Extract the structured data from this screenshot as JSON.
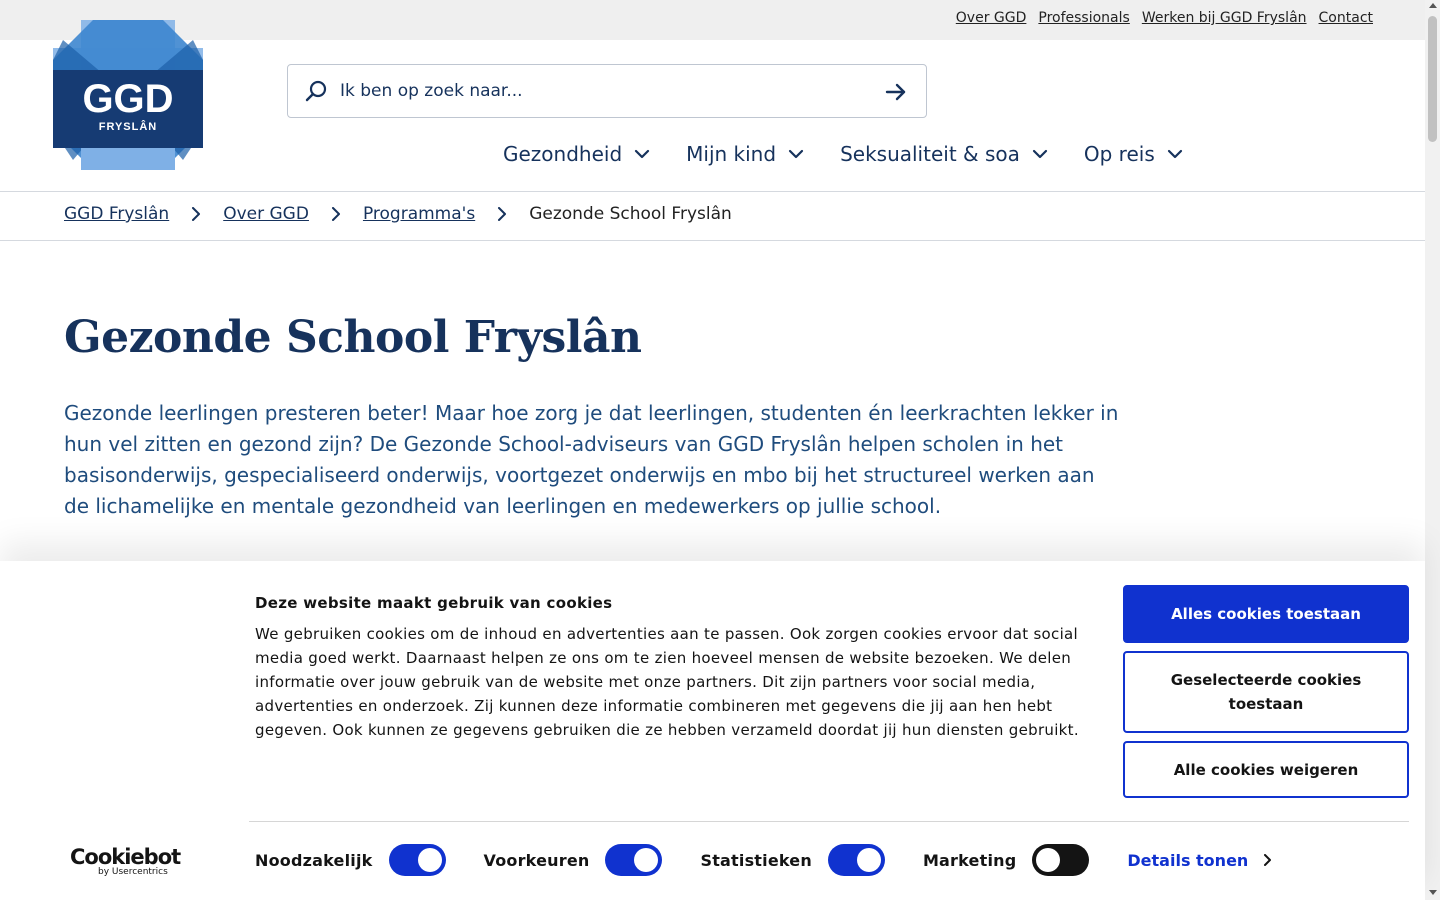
{
  "topbar": {
    "links": [
      "Over GGD",
      "Professionals",
      "Werken bij GGD Fryslân",
      "Contact"
    ]
  },
  "logo": {
    "text": "GGD",
    "subtext": "FRYSLÂN"
  },
  "search": {
    "placeholder": "Ik ben op zoek naar..."
  },
  "nav": [
    "Gezondheid",
    "Mijn kind",
    "Seksualiteit & soa",
    "Op reis"
  ],
  "breadcrumb": {
    "items": [
      "GGD Fryslân",
      "Over GGD",
      "Programma's"
    ],
    "current": "Gezonde School Fryslân"
  },
  "page": {
    "title": "Gezonde School Fryslân",
    "intro": "Gezonde leerlingen presteren beter! Maar hoe zorg je dat leerlingen, studenten én leerkrachten lekker in hun vel zitten en gezond zijn? De Gezonde School-adviseurs van GGD Fryslân helpen scholen in het basisonderwijs, gespecialiseerd onderwijs, voortgezet onderwijs en mbo bij het structureel werken aan de lichamelijke en mentale gezondheid van leerlingen en medewerkers op jullie school."
  },
  "cookie": {
    "title": "Deze website maakt gebruik van cookies",
    "text": "We gebruiken cookies om de inhoud en advertenties aan te passen. Ook zorgen cookies ervoor dat social media goed werkt. Daarnaast helpen ze ons om te zien hoeveel mensen de website bezoeken. We delen informatie over jouw gebruik van de website met onze partners. Dit zijn partners voor social media, advertenties en onderzoek. Zij kunnen deze informatie combineren met gegevens die jij aan hen hebt gegeven. Ook kunnen ze gegevens gebruiken die ze hebben verzameld doordat jij hun diensten gebruikt.",
    "buttons": {
      "allow_all": "Alles cookies toestaan",
      "allow_selected": "Geselecteerde cookies toestaan",
      "deny_all": "Alle cookies weigeren"
    },
    "toggles": [
      {
        "label": "Noodzakelijk",
        "on": true
      },
      {
        "label": "Voorkeuren",
        "on": true
      },
      {
        "label": "Statistieken",
        "on": true
      },
      {
        "label": "Marketing",
        "on": false
      }
    ],
    "details": "Details tonen",
    "brand": {
      "name": "Cookiebot",
      "sub": "by Usercentrics"
    }
  },
  "colors": {
    "brand_navy": "#16325c",
    "cookie_blue": "#1032cf",
    "topbar_bg": "#efefef"
  }
}
